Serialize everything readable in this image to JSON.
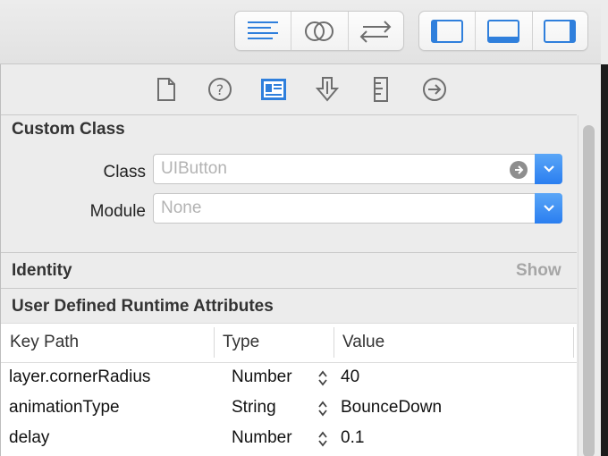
{
  "toolbar": {
    "editor_group": [
      "standard-editor-icon",
      "assistant-editor-icon",
      "version-editor-icon"
    ],
    "panel_group": [
      "navigator-toggle-icon",
      "debug-area-toggle-icon",
      "utilities-toggle-icon"
    ]
  },
  "inspector_tabs": [
    "file-inspector-icon",
    "quick-help-icon",
    "identity-inspector-icon",
    "attributes-inspector-icon",
    "size-inspector-icon",
    "connections-inspector-icon"
  ],
  "custom_class": {
    "title": "Custom Class",
    "class_label": "Class",
    "class_placeholder": "UIButton",
    "module_label": "Module",
    "module_placeholder": "None"
  },
  "identity": {
    "title": "Identity",
    "show_label": "Show"
  },
  "runtime_attributes": {
    "title": "User Defined Runtime Attributes",
    "columns": [
      "Key Path",
      "Type",
      "Value"
    ],
    "rows": [
      {
        "key_path": "layer.cornerRadius",
        "type": "Number",
        "value": "40"
      },
      {
        "key_path": "animationType",
        "type": "String",
        "value": "BounceDown"
      },
      {
        "key_path": "delay",
        "type": "Number",
        "value": "0.1"
      }
    ]
  },
  "colors": {
    "accent": "#2a7ef0",
    "selected_tab": "#2f7fdc",
    "icon_gray": "#6e6e6e",
    "show_gray": "#a6a6a6"
  }
}
